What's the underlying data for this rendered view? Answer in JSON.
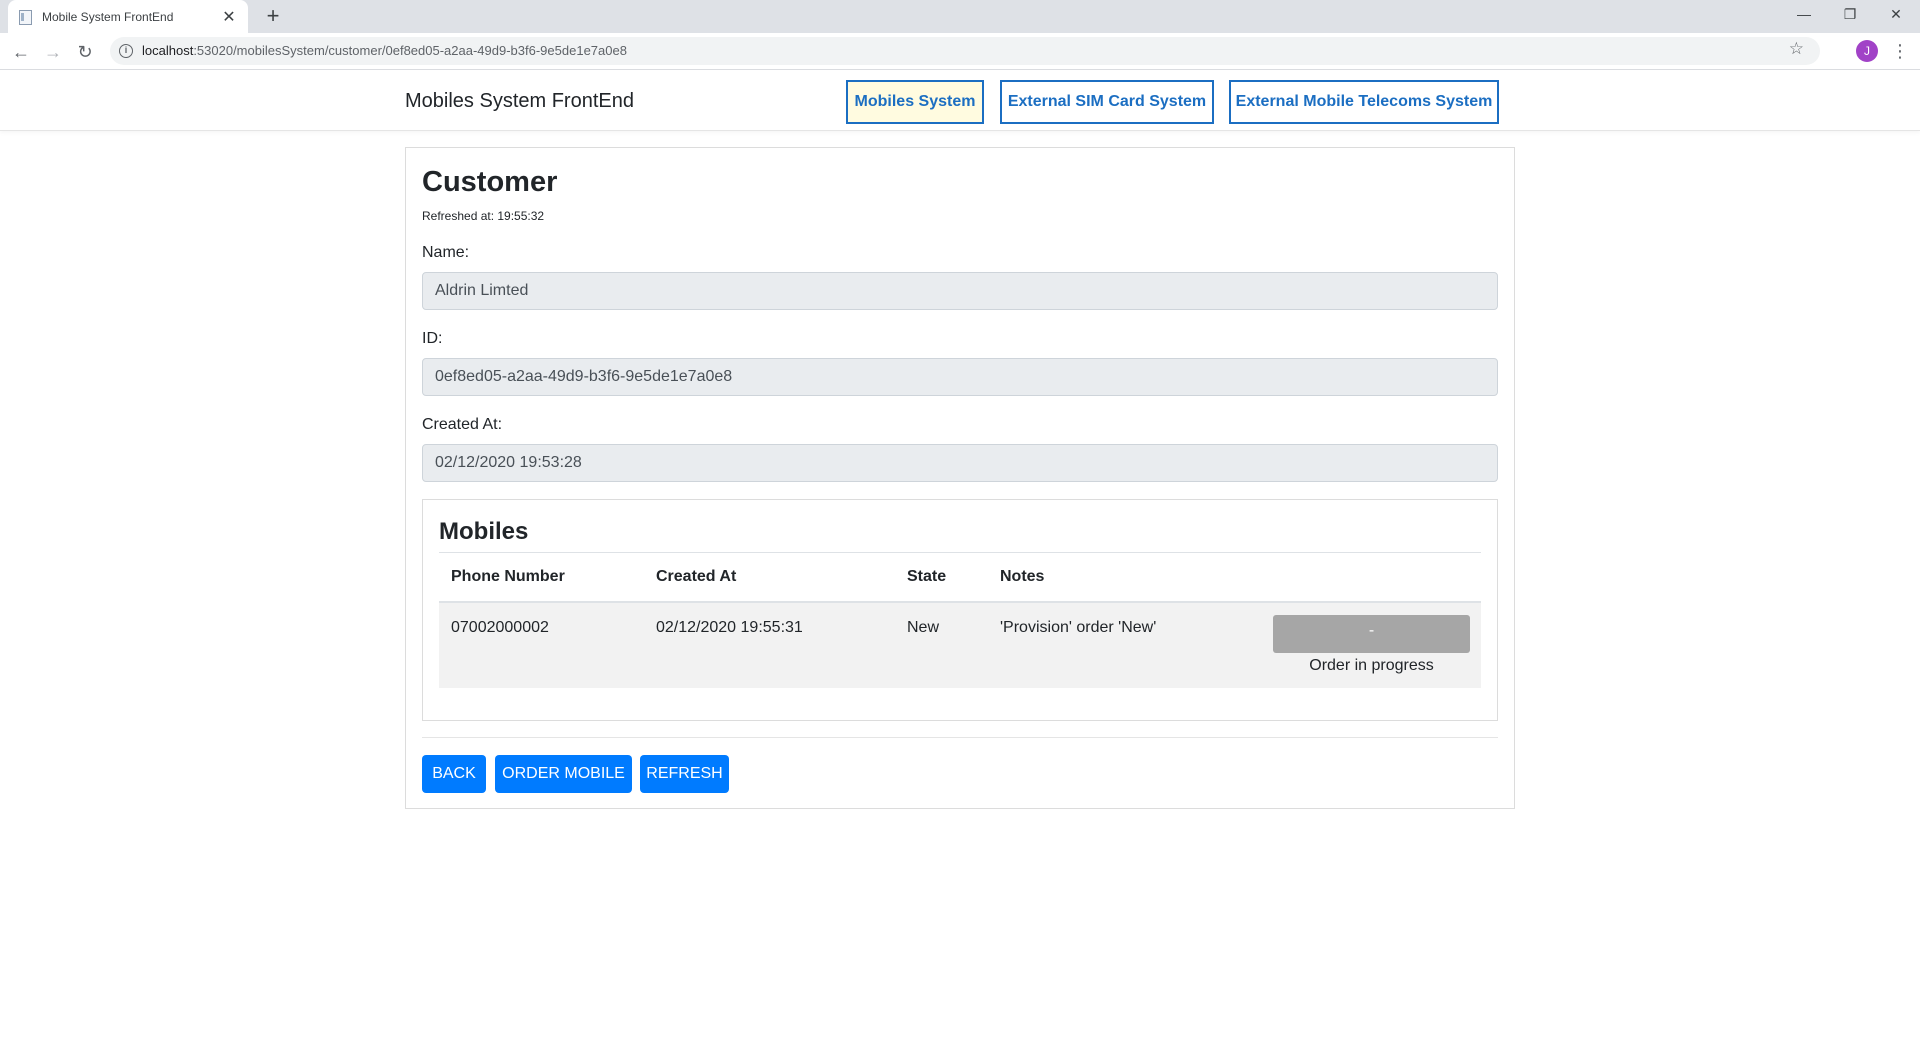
{
  "browser": {
    "tab_title": "Mobile System FrontEnd",
    "url_host": "localhost",
    "url_rest": ":53020/mobilesSystem/customer/0ef8ed05-a2aa-49d9-b3f6-9e5de1e7a0e8",
    "profile_initial": "J"
  },
  "nav": {
    "brand": "Mobiles System FrontEnd",
    "links": [
      "Mobiles System",
      "External SIM Card System",
      "External Mobile Telecoms System"
    ]
  },
  "customer": {
    "title": "Customer",
    "refreshed": "Refreshed at: 19:55:32",
    "name_label": "Name:",
    "name_value": "Aldrin Limted",
    "id_label": "ID:",
    "id_value": "0ef8ed05-a2aa-49d9-b3f6-9e5de1e7a0e8",
    "created_label": "Created At:",
    "created_value": "02/12/2020 19:53:28"
  },
  "mobiles": {
    "title": "Mobiles",
    "columns": [
      "Phone Number",
      "Created At",
      "State",
      "Notes"
    ],
    "rows": [
      {
        "phone": "07002000002",
        "created": "02/12/2020 19:55:31",
        "state": "New",
        "notes": "'Provision' order 'New'",
        "action_label": "-",
        "status_text": "Order in progress"
      }
    ]
  },
  "actions": {
    "back": "BACK",
    "order": "ORDER MOBILE",
    "refresh": "REFRESH"
  }
}
